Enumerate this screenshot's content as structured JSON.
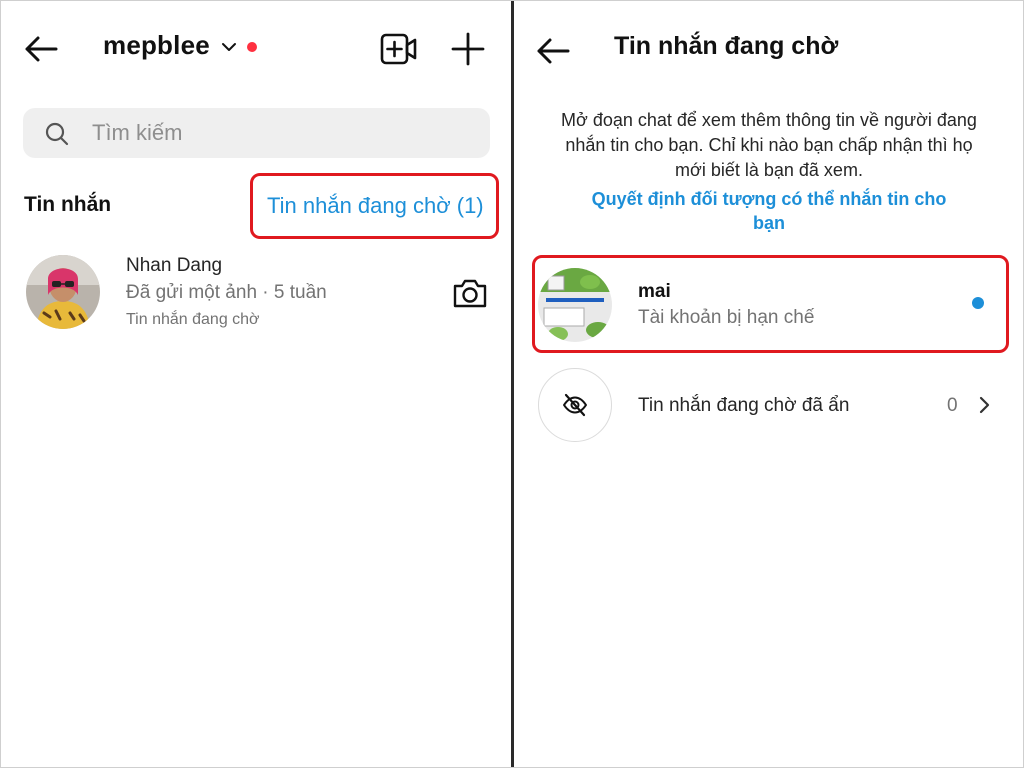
{
  "left": {
    "header": {
      "username": "mepblee",
      "icons": [
        "back-arrow-icon",
        "chevron-down-icon",
        "notification-dot",
        "new-video-icon",
        "plus-icon"
      ]
    },
    "search": {
      "placeholder": "Tìm kiếm"
    },
    "section": {
      "title": "Tin nhắn",
      "pending_link": "Tin nhắn đang chờ (1)"
    },
    "conversations": [
      {
        "name": "Nhan Dang",
        "preview": "Đã gửi một ảnh · 5 tuần",
        "status": "Tin nhắn đang chờ",
        "action_icon": "camera-icon"
      }
    ]
  },
  "right": {
    "title": "Tin nhắn đang chờ",
    "description": "Mở đoạn chat để xem thêm thông tin về người đang nhắn tin cho bạn. Chỉ khi nào bạn chấp nhận thì họ mới biết là bạn đã xem.",
    "link": "Quyết định đối tượng có thể nhắn tin cho bạn",
    "requests": [
      {
        "name": "mai",
        "subtitle": "Tài khoản bị hạn chế",
        "unread": true
      }
    ],
    "hidden": {
      "label": "Tin nhắn đang chờ đã ẩn",
      "count": "0"
    }
  },
  "colors": {
    "accent_blue": "#1d8fd8",
    "highlight_red": "#e0191f",
    "notification_red": "#ff3040",
    "search_bg": "#efefef",
    "muted_text": "#737373"
  }
}
